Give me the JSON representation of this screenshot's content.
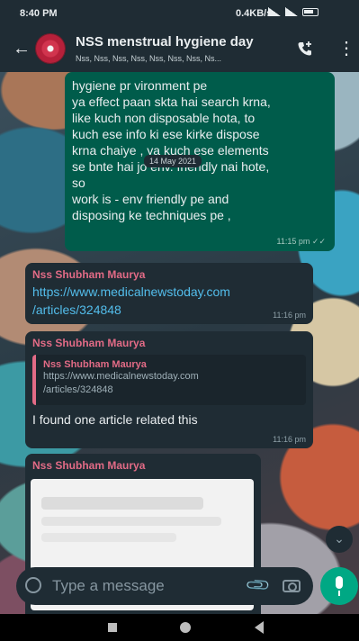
{
  "status_bar": {
    "time": "8:40 PM",
    "network_speed": "0.4KB/s"
  },
  "header": {
    "back_icon": "arrow-left-icon",
    "title": "NSS menstrual hygiene day",
    "subtitle": "Nss, Nss, Nss, Nss, Nss, Nss, Nss, Ns...",
    "call_icon": "add-call-icon",
    "menu_icon": "more-vertical-icon"
  },
  "messages": [
    {
      "type": "outgoing",
      "text": "hygiene pr          vironment pe\nya effect paan skta hai search krna,\nlike kuch non disposable hota, to\nkuch ese info ki ese kirke dispose\nkrna chaiye , ya kuch ese elements\nse bnte hai jo env. friendly nai hote,\nso\nwork is - env friendly pe and\ndisposing ke techniques pe ,",
      "time": "11:15 pm"
    },
    {
      "type": "incoming",
      "sender": "Nss Shubham Maurya",
      "link": "https://www.medicalnewstoday.com\n/articles/324848",
      "time": "11:16 pm"
    },
    {
      "type": "incoming",
      "sender": "Nss Shubham Maurya",
      "quoted_sender": "Nss Shubham Maurya",
      "quoted_text": "https://www.medicalnewstoday.com\n/articles/324848",
      "text": "I found one article related this",
      "time": "11:16 pm"
    },
    {
      "type": "incoming",
      "sender": "Nss Shubham Maurya"
    }
  ],
  "date_chip": "14 May 2021",
  "input": {
    "placeholder": "Type a message"
  },
  "colors": {
    "outgoing_bubble": "#005c4b",
    "incoming_bubble": "#1f2c34",
    "sender_name": "#e26b86",
    "link": "#53bdeb",
    "accent": "#00a884"
  }
}
